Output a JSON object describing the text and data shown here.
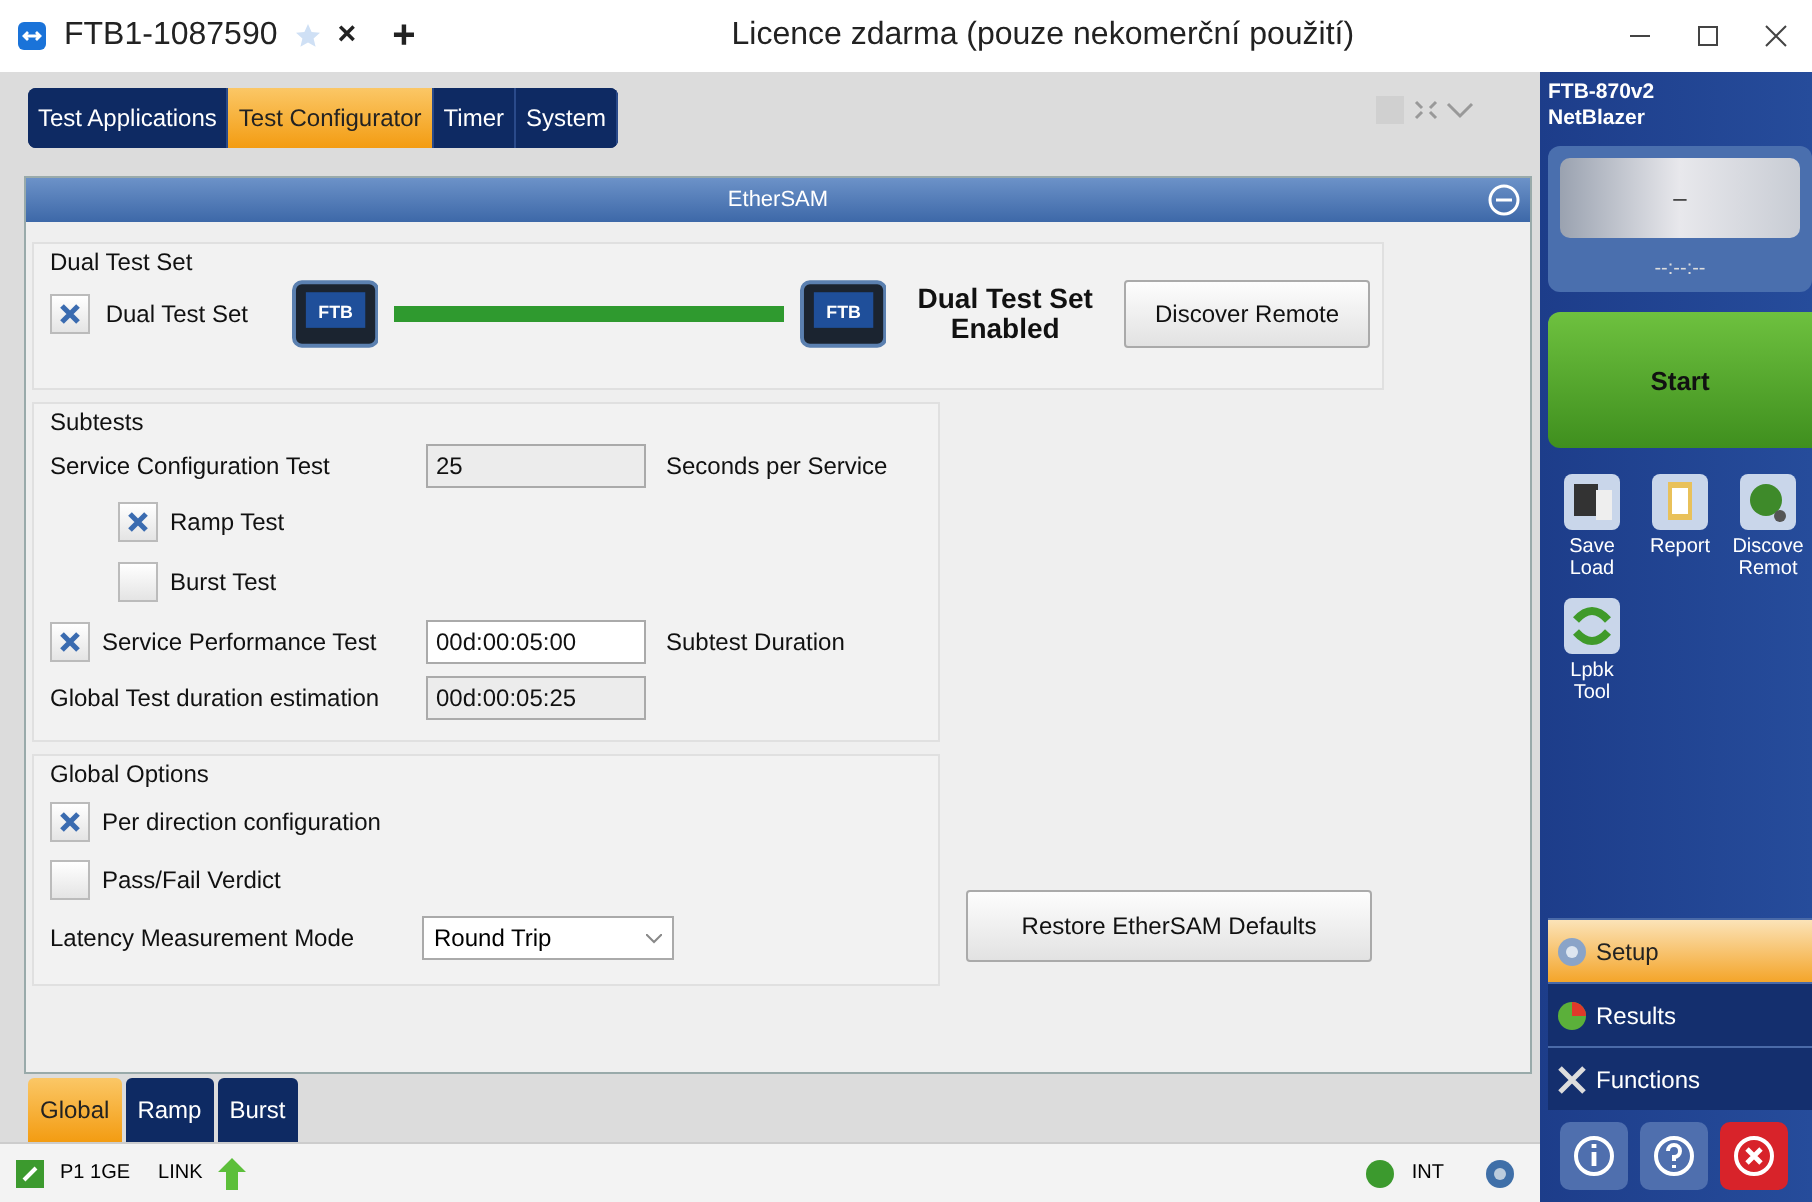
{
  "window": {
    "tab_title": "FTB1-1087590",
    "tab_close": "×",
    "new_tab": "+",
    "banner": "Licence zdarma (pouze nekomerční použití)"
  },
  "app_tabs": [
    {
      "label": "Test Applications",
      "selected": false
    },
    {
      "label": "Test Configurator",
      "selected": true
    },
    {
      "label": "Timer",
      "selected": false
    },
    {
      "label": "System",
      "selected": false
    }
  ],
  "panel": {
    "title": "EtherSAM"
  },
  "dual_test_set": {
    "heading": "Dual Test Set",
    "checkbox": {
      "label": "Dual Test Set",
      "checked": true
    },
    "devices": [
      "FTB",
      "FTB"
    ],
    "status": "Dual Test Set Enabled",
    "button": "Discover Remote"
  },
  "subtests": {
    "heading": "Subtests",
    "rows": [
      {
        "kind": "field",
        "label": "Service Configuration Test",
        "value": "25",
        "readonly": true,
        "unit": "Seconds per Service"
      },
      {
        "kind": "subcheck",
        "label": "Ramp Test",
        "checked": true
      },
      {
        "kind": "subcheck",
        "label": "Burst Test",
        "checked": false
      },
      {
        "kind": "checkfield",
        "label": "Service Performance Test",
        "checked": true,
        "value": "00d:00:05:00",
        "readonly": false,
        "unit": "Subtest Duration"
      },
      {
        "kind": "field",
        "label": "Global Test duration estimation",
        "value": "00d:00:05:25",
        "readonly": true
      }
    ]
  },
  "global_options": {
    "heading": "Global Options",
    "rows": [
      {
        "kind": "check",
        "label": "Per direction configuration",
        "checked": true
      },
      {
        "kind": "check",
        "label": "Pass/Fail Verdict",
        "checked": false
      },
      {
        "kind": "select",
        "label": "Latency Measurement Mode",
        "value": "Round Trip"
      }
    ]
  },
  "restore_button": "Restore EtherSAM Defaults",
  "bottom_tabs": [
    {
      "label": "Global",
      "selected": true
    },
    {
      "label": "Ramp",
      "selected": false
    },
    {
      "label": "Burst",
      "selected": false
    }
  ],
  "status_bar": {
    "port": "P1 1GE",
    "link": "LINK",
    "clock": "INT"
  },
  "side": {
    "title": [
      "FTB-870v2",
      "NetBlazer"
    ],
    "display": "–",
    "timer": "--:--:--",
    "start": "Start",
    "tools": [
      {
        "kind": "save",
        "lines": [
          "Save",
          "Load"
        ]
      },
      {
        "kind": "report",
        "lines": [
          "Report"
        ]
      },
      {
        "kind": "discover",
        "lines": [
          "Discove",
          "Remot"
        ]
      },
      {
        "kind": "loopback",
        "lines": [
          "Lpbk",
          "Tool"
        ]
      }
    ],
    "nav": [
      {
        "kind": "setup",
        "label": "Setup",
        "selected": true
      },
      {
        "kind": "results",
        "label": "Results",
        "selected": false
      },
      {
        "kind": "functions",
        "label": "Functions",
        "selected": false
      }
    ]
  }
}
